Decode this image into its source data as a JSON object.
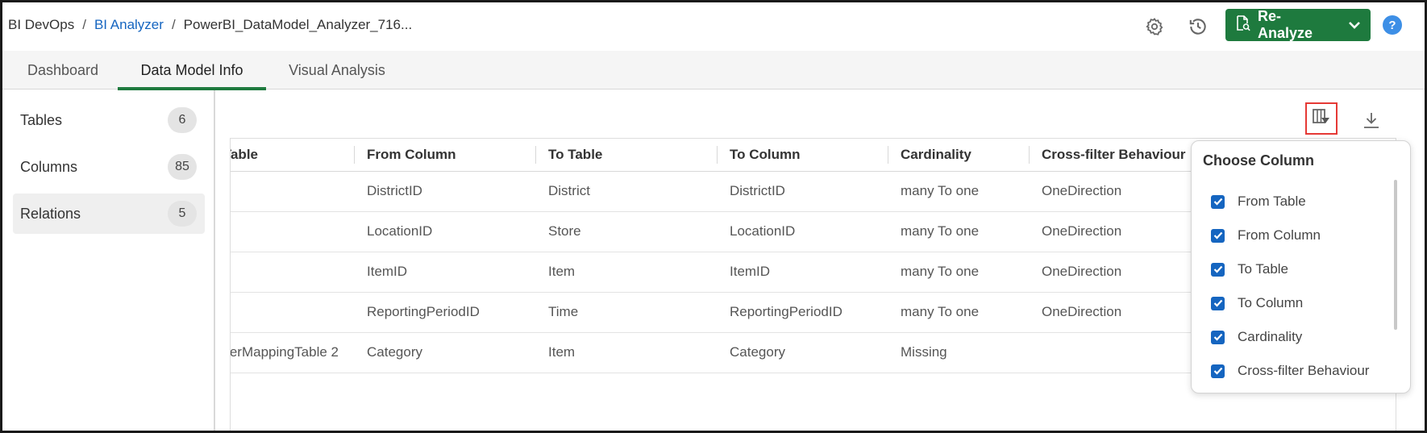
{
  "breadcrumb": {
    "items": [
      {
        "label": "BI DevOps"
      },
      {
        "label": "BI Analyzer"
      },
      {
        "label": "PowerBI_DataModel_Analyzer_716..."
      }
    ],
    "separator": "/"
  },
  "header": {
    "settings_icon": "gear-icon",
    "history_icon": "history-icon",
    "reanalyze_label": "Re-Analyze",
    "help_label": "?"
  },
  "tabs": [
    {
      "label": "Dashboard",
      "active": false
    },
    {
      "label": "Data Model Info",
      "active": true
    },
    {
      "label": "Visual Analysis",
      "active": false
    }
  ],
  "sidebar": {
    "items": [
      {
        "label": "Tables",
        "count": "6",
        "active": false
      },
      {
        "label": "Columns",
        "count": "85",
        "active": false
      },
      {
        "label": "Relations",
        "count": "5",
        "active": true
      }
    ]
  },
  "toolbar": {
    "choose_columns_icon": "column-filter-icon",
    "download_icon": "download-icon"
  },
  "table": {
    "headers": [
      "Table",
      "From Column",
      "To Table",
      "To Column",
      "Cardinality",
      "Cross-filter Behaviour"
    ],
    "rows": [
      [
        "",
        "DistrictID",
        "District",
        "DistrictID",
        "many To one",
        "OneDirection"
      ],
      [
        "",
        "LocationID",
        "Store",
        "LocationID",
        "many To one",
        "OneDirection"
      ],
      [
        "",
        "ItemID",
        "Item",
        "ItemID",
        "many To one",
        "OneDirection"
      ],
      [
        "",
        "ReportingPeriodID",
        "Time",
        "ReportingPeriodID",
        "many To one",
        "OneDirection"
      ],
      [
        "erMappingTable 2",
        "Category",
        "Item",
        "Category",
        "Missing",
        ""
      ]
    ]
  },
  "choose_column": {
    "title": "Choose Column",
    "options": [
      {
        "label": "From Table",
        "checked": true
      },
      {
        "label": "From Column",
        "checked": true
      },
      {
        "label": "To Table",
        "checked": true
      },
      {
        "label": "To Column",
        "checked": true
      },
      {
        "label": "Cardinality",
        "checked": true
      },
      {
        "label": "Cross-filter Behaviour",
        "checked": true
      }
    ]
  },
  "colors": {
    "accent_green": "#1e7a3e",
    "link_blue": "#1565c0",
    "checkbox_blue": "#1565c0",
    "help_blue": "#3d8fe6",
    "highlight_red": "#e53935"
  }
}
